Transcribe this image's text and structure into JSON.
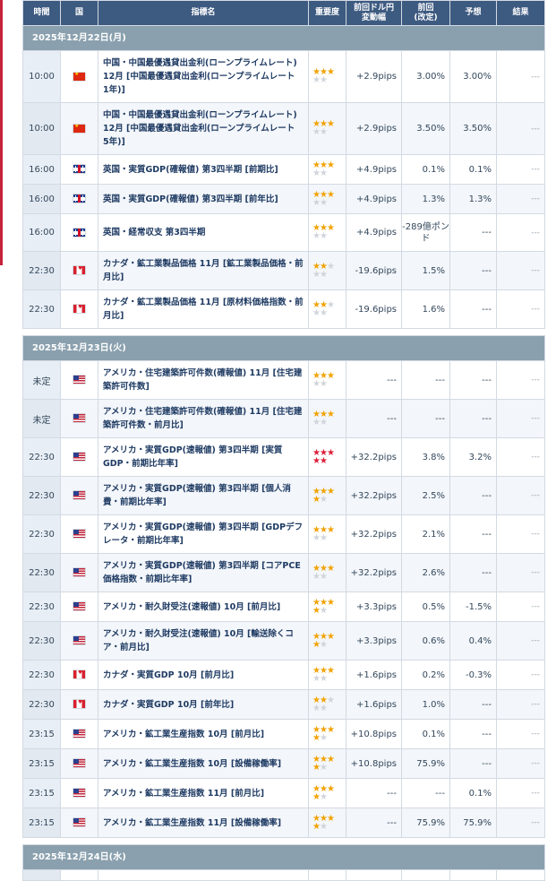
{
  "header": {
    "time": "時間",
    "country": "国",
    "indicator": "指標名",
    "importance": "重要度",
    "prev_move_line1": "前回ドル円",
    "prev_move_line2": "変動幅",
    "prev_line1": "前回",
    "prev_line2": "(改定)",
    "forecast": "予想",
    "result": "結果"
  },
  "colors": {
    "header_bg": "#3d5a80",
    "date_bar_bg": "#8aa0ae",
    "star_on": "#f2a200",
    "star_red": "#dd1f3a",
    "up": "#e23b4d",
    "down": "#2a8bd8"
  },
  "days": [
    {
      "date": "2025年12月22日(月)",
      "rows": [
        {
          "time": "10:00",
          "country": "china-flag",
          "name": "中国・中国最優遇貸出金利(ローンプライムレート) 12月 [中国最優遇貸出金利(ローンプライムレート　1年)]",
          "stars": 3,
          "stars_red": false,
          "move": "+2.9pips",
          "move_dir": "pos",
          "prev": "3.00%",
          "forecast": "3.00%",
          "result": "---"
        },
        {
          "time": "10:00",
          "country": "china-flag",
          "name": "中国・中国最優遇貸出金利(ローンプライムレート) 12月 [中国最優遇貸出金利(ローンプライムレート　5年)]",
          "stars": 3,
          "stars_red": false,
          "move": "+2.9pips",
          "move_dir": "pos",
          "prev": "3.50%",
          "forecast": "3.50%",
          "result": "---"
        },
        {
          "time": "16:00",
          "country": "uk-flag",
          "name": "英国・実質GDP(確報値) 第3四半期 [前期比]",
          "stars": 3,
          "stars_red": false,
          "move": "+4.9pips",
          "move_dir": "pos",
          "prev": "0.1%",
          "forecast": "0.1%",
          "result": "---"
        },
        {
          "time": "16:00",
          "country": "uk-flag",
          "name": "英国・実質GDP(確報値) 第3四半期 [前年比]",
          "stars": 3,
          "stars_red": false,
          "move": "+4.9pips",
          "move_dir": "pos",
          "prev": "1.3%",
          "forecast": "1.3%",
          "result": "---"
        },
        {
          "time": "16:00",
          "country": "uk-flag",
          "name": "英国・経常収支 第3四半期",
          "stars": 3,
          "stars_red": false,
          "move": "+4.9pips",
          "move_dir": "pos",
          "prev": "-289億ポンド",
          "forecast": "---",
          "result": "---"
        },
        {
          "time": "22:30",
          "country": "canada-flag",
          "name": "カナダ・鉱工業製品価格 11月 [鉱工業製品価格・前月比]",
          "stars": 2,
          "stars_red": false,
          "move": "-19.6pips",
          "move_dir": "down",
          "prev": "1.5%",
          "forecast": "---",
          "result": "---"
        },
        {
          "time": "22:30",
          "country": "canada-flag",
          "name": "カナダ・鉱工業製品価格 11月 [原材料価格指数・前月比]",
          "stars": 2,
          "stars_red": false,
          "move": "-19.6pips",
          "move_dir": "down",
          "prev": "1.6%",
          "forecast": "---",
          "result": "---"
        }
      ]
    },
    {
      "date": "2025年12月23日(火)",
      "rows": [
        {
          "time": "未定",
          "country": "us-flag",
          "name": "アメリカ・住宅建築許可件数(確報値) 11月 [住宅建築許可件数]",
          "stars": 3,
          "stars_red": false,
          "move": "---",
          "move_dir": "none",
          "prev": "---",
          "forecast": "---",
          "result": "---"
        },
        {
          "time": "未定",
          "country": "us-flag",
          "name": "アメリカ・住宅建築許可件数(確報値) 11月 [住宅建築許可件数・前月比]",
          "stars": 3,
          "stars_red": false,
          "move": "---",
          "move_dir": "none",
          "prev": "---",
          "forecast": "---",
          "result": "---"
        },
        {
          "time": "22:30",
          "country": "us-flag",
          "name": "アメリカ・実質GDP(速報値) 第3四半期 [実質GDP・前期比年率]",
          "stars": 5,
          "stars_red": true,
          "move": "+32.2pips",
          "move_dir": "up",
          "prev": "3.8%",
          "forecast": "3.2%",
          "result": "---"
        },
        {
          "time": "22:30",
          "country": "us-flag",
          "name": "アメリカ・実質GDP(速報値) 第3四半期 [個人消費・前期比年率]",
          "stars": 4,
          "stars_red": false,
          "move": "+32.2pips",
          "move_dir": "up",
          "prev": "2.5%",
          "forecast": "---",
          "result": "---"
        },
        {
          "time": "22:30",
          "country": "us-flag",
          "name": "アメリカ・実質GDP(速報値) 第3四半期 [GDPデフレータ・前期比年率]",
          "stars": 3,
          "stars_red": false,
          "move": "+32.2pips",
          "move_dir": "up",
          "prev": "2.1%",
          "forecast": "---",
          "result": "---"
        },
        {
          "time": "22:30",
          "country": "us-flag",
          "name": "アメリカ・実質GDP(速報値) 第3四半期 [コアPCE価格指数・前期比年率]",
          "stars": 3,
          "stars_red": false,
          "move": "+32.2pips",
          "move_dir": "up",
          "prev": "2.6%",
          "forecast": "---",
          "result": "---"
        },
        {
          "time": "22:30",
          "country": "us-flag",
          "name": "アメリカ・耐久財受注(速報値) 10月 [前月比]",
          "stars": 4,
          "stars_red": false,
          "move": "+3.3pips",
          "move_dir": "pos",
          "prev": "0.5%",
          "forecast": "-1.5%",
          "result": "---"
        },
        {
          "time": "22:30",
          "country": "us-flag",
          "name": "アメリカ・耐久財受注(速報値) 10月 [輸送除くコア・前月比]",
          "stars": 4,
          "stars_red": false,
          "move": "+3.3pips",
          "move_dir": "pos",
          "prev": "0.6%",
          "forecast": "0.4%",
          "result": "---"
        },
        {
          "time": "22:30",
          "country": "canada-flag",
          "name": "カナダ・実質GDP 10月 [前月比]",
          "stars": 3,
          "stars_red": false,
          "move": "+1.6pips",
          "move_dir": "pos",
          "prev": "0.2%",
          "forecast": "-0.3%",
          "result": "---"
        },
        {
          "time": "22:30",
          "country": "canada-flag",
          "name": "カナダ・実質GDP 10月 [前年比]",
          "stars": 2,
          "stars_red": false,
          "move": "+1.6pips",
          "move_dir": "pos",
          "prev": "1.0%",
          "forecast": "---",
          "result": "---"
        },
        {
          "time": "23:15",
          "country": "us-flag",
          "name": "アメリカ・鉱工業生産指数 10月 [前月比]",
          "stars": 4,
          "stars_red": false,
          "move": "+10.8pips",
          "move_dir": "up",
          "prev": "0.1%",
          "forecast": "---",
          "result": "---"
        },
        {
          "time": "23:15",
          "country": "us-flag",
          "name": "アメリカ・鉱工業生産指数 10月 [設備稼働率]",
          "stars": 4,
          "stars_red": false,
          "move": "+10.8pips",
          "move_dir": "up",
          "prev": "75.9%",
          "forecast": "---",
          "result": "---"
        },
        {
          "time": "23:15",
          "country": "us-flag",
          "name": "アメリカ・鉱工業生産指数 11月 [前月比]",
          "stars": 4,
          "stars_red": false,
          "move": "---",
          "move_dir": "none",
          "prev": "---",
          "forecast": "0.1%",
          "result": "---"
        },
        {
          "time": "23:15",
          "country": "us-flag",
          "name": "アメリカ・鉱工業生産指数 11月 [設備稼働率]",
          "stars": 4,
          "stars_red": false,
          "move": "---",
          "move_dir": "none",
          "prev": "75.9%",
          "forecast": "75.9%",
          "result": "---"
        }
      ]
    },
    {
      "date": "2025年12月24日(水)",
      "rows": []
    }
  ]
}
